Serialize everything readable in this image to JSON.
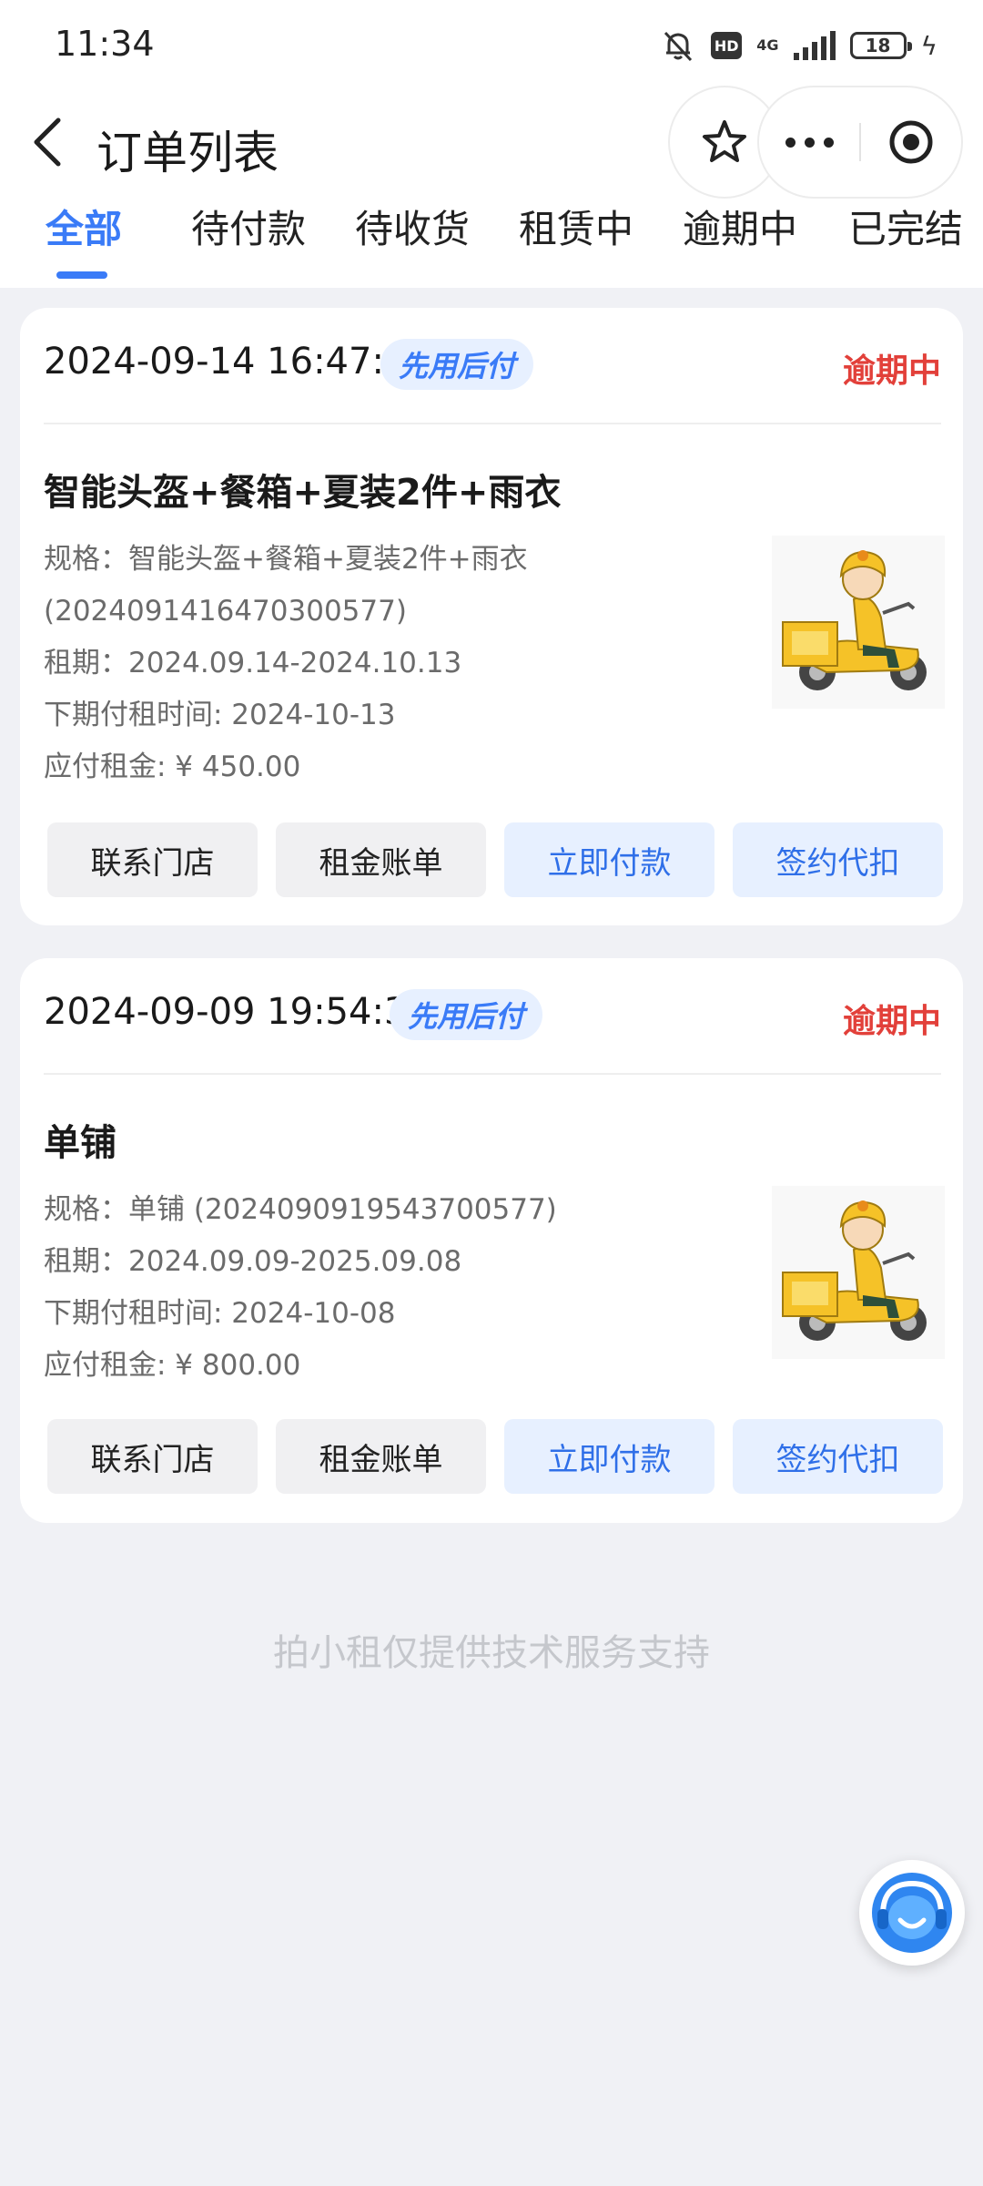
{
  "status_bar": {
    "time": "11:34",
    "network": "4G",
    "hd": "HD",
    "battery": "18"
  },
  "nav": {
    "title": "订单列表"
  },
  "tabs": [
    {
      "label": "全部",
      "active": true
    },
    {
      "label": "待付款"
    },
    {
      "label": "待收货"
    },
    {
      "label": "租赁中"
    },
    {
      "label": "逾期中"
    },
    {
      "label": "已完结"
    }
  ],
  "orders": [
    {
      "datetime": "2024-09-14 16:47:03",
      "badge": "先用后付",
      "status": "逾期中",
      "product": "智能头盔+餐箱+夏装2件+雨衣",
      "spec_line1": "规格：智能头盔+餐箱+夏装2件+雨衣",
      "spec_line2": "(2024091416470300577)",
      "period": "租期：2024.09.14-2024.10.13",
      "next_payment": "下期付租时间: 2024-10-13",
      "rent_due": "应付租金: ¥ 450.00",
      "buttons": [
        "联系门店",
        "租金账单",
        "立即付款",
        "签约代扣"
      ]
    },
    {
      "datetime": "2024-09-09 19:54:37",
      "badge": "先用后付",
      "status": "逾期中",
      "product": "单铺",
      "spec_line1": "规格：单铺 (2024090919543700577)",
      "period": "租期：2024.09.09-2025.09.08",
      "next_payment": "下期付租时间: 2024-10-08",
      "rent_due": "应付租金: ¥ 800.00",
      "buttons": [
        "联系门店",
        "租金账单",
        "立即付款",
        "签约代扣"
      ]
    }
  ],
  "footer": "拍小租仅提供技术服务支持",
  "colors": {
    "accent": "#3a7bf7",
    "overdue": "#e2403a",
    "badge_bg": "#e7f0ff"
  },
  "icons": [
    "bell-muted-icon",
    "back-arrow-icon",
    "star-icon",
    "more-icon",
    "target-icon",
    "customer-service-icon",
    "scooter-rider-image"
  ]
}
